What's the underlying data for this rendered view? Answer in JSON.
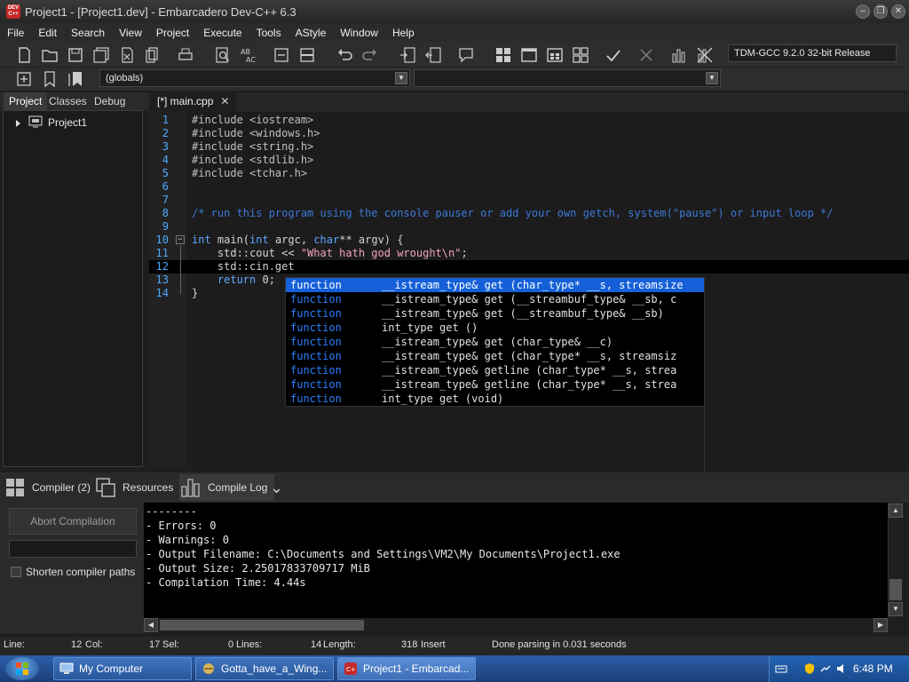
{
  "window": {
    "app_icon_text": "DEV C++",
    "title": "Project1 - [Project1.dev] - Embarcadero Dev-C++ 6.3",
    "minimize_glyph": "–",
    "restore_glyph": "❐",
    "close_glyph": "✕"
  },
  "menu": [
    "File",
    "Edit",
    "Search",
    "View",
    "Project",
    "Execute",
    "Tools",
    "AStyle",
    "Window",
    "Help"
  ],
  "toolbar": {
    "compiler": "TDM-GCC 9.2.0 32-bit Release",
    "scope": "(globals)",
    "member": ""
  },
  "left_panel": {
    "tabs": [
      "Project",
      "Classes",
      "Debug"
    ],
    "active_tab": "Project",
    "tree": [
      {
        "label": "Project1"
      }
    ]
  },
  "editor": {
    "tab_label": "[*] main.cpp",
    "current_line": 12,
    "lines": [
      {
        "n": "1",
        "text": "#include <iostream>"
      },
      {
        "n": "2",
        "text": "#include <windows.h>"
      },
      {
        "n": "3",
        "text": "#include <string.h>"
      },
      {
        "n": "4",
        "text": "#include <stdlib.h>"
      },
      {
        "n": "5",
        "text": "#include <tchar.h>"
      },
      {
        "n": "6",
        "text": ""
      },
      {
        "n": "7",
        "text": ""
      },
      {
        "n": "8",
        "text": "/* run this program using the console pauser or add your own getch, system(\"pause\") or input loop */"
      },
      {
        "n": "9",
        "text": ""
      },
      {
        "n": "10",
        "text": "int main(int argc, char** argv) {"
      },
      {
        "n": "11",
        "text": "    std::cout << \"What hath god wrought\\n\";"
      },
      {
        "n": "12",
        "text": "    std::cin.get"
      },
      {
        "n": "13",
        "text": "    return 0;"
      },
      {
        "n": "14",
        "text": "}"
      }
    ]
  },
  "completion": {
    "selected_index": 0,
    "items": [
      {
        "kind": "function",
        "signature": "__istream_type& get (char_type* __s, streamsize"
      },
      {
        "kind": "function",
        "signature": "__istream_type& get (__streambuf_type& __sb, c"
      },
      {
        "kind": "function",
        "signature": "__istream_type& get (__streambuf_type& __sb)"
      },
      {
        "kind": "function",
        "signature": "int_type get ()"
      },
      {
        "kind": "function",
        "signature": "__istream_type& get (char_type& __c)"
      },
      {
        "kind": "function",
        "signature": "__istream_type& get (char_type* __s, streamsiz"
      },
      {
        "kind": "function",
        "signature": "__istream_type& getline (char_type* __s, strea"
      },
      {
        "kind": "function",
        "signature": "__istream_type& getline (char_type* __s, strea"
      },
      {
        "kind": "function",
        "signature": "int_type get (void)"
      }
    ]
  },
  "bottom": {
    "tabs": [
      {
        "label": "Compiler (2)",
        "icon": "grid-icon"
      },
      {
        "label": "Resources",
        "icon": "resources-icon"
      },
      {
        "label": "Compile Log",
        "icon": "chart-icon"
      }
    ],
    "active_tab": "Compile Log",
    "collapse_glyph": "⌄",
    "abort_label": "Abort Compilation",
    "shorten_label": "Shorten compiler paths",
    "log": [
      "--------",
      "- Errors: 0",
      "- Warnings: 0",
      "- Output Filename: C:\\Documents and Settings\\VM2\\My Documents\\Project1.exe",
      "- Output Size: 2.25017833709717 MiB",
      "- Compilation Time: 4.44s"
    ]
  },
  "status": {
    "line_label": "Line:",
    "line": "12",
    "col_label": "Col:",
    "col": "17",
    "sel_label": "Sel:",
    "sel": "0",
    "lines_label": "Lines:",
    "lines": "14",
    "length_label": "Length:",
    "length": "318",
    "mode": "Insert",
    "message": "Done parsing in 0.031 seconds"
  },
  "taskbar": {
    "tasks": [
      {
        "label": "My Computer"
      },
      {
        "label": "Gotta_have_a_Wing..."
      },
      {
        "label": "Project1 - Embarcad..."
      }
    ],
    "active_task": 2,
    "time": "6:48 PM"
  },
  "colors": {
    "accent": "#1560d8",
    "keyword": "#5fa8ff",
    "string": "#f2a3c1",
    "comment": "#3c78d8",
    "line_number": "#4fa8ff"
  }
}
